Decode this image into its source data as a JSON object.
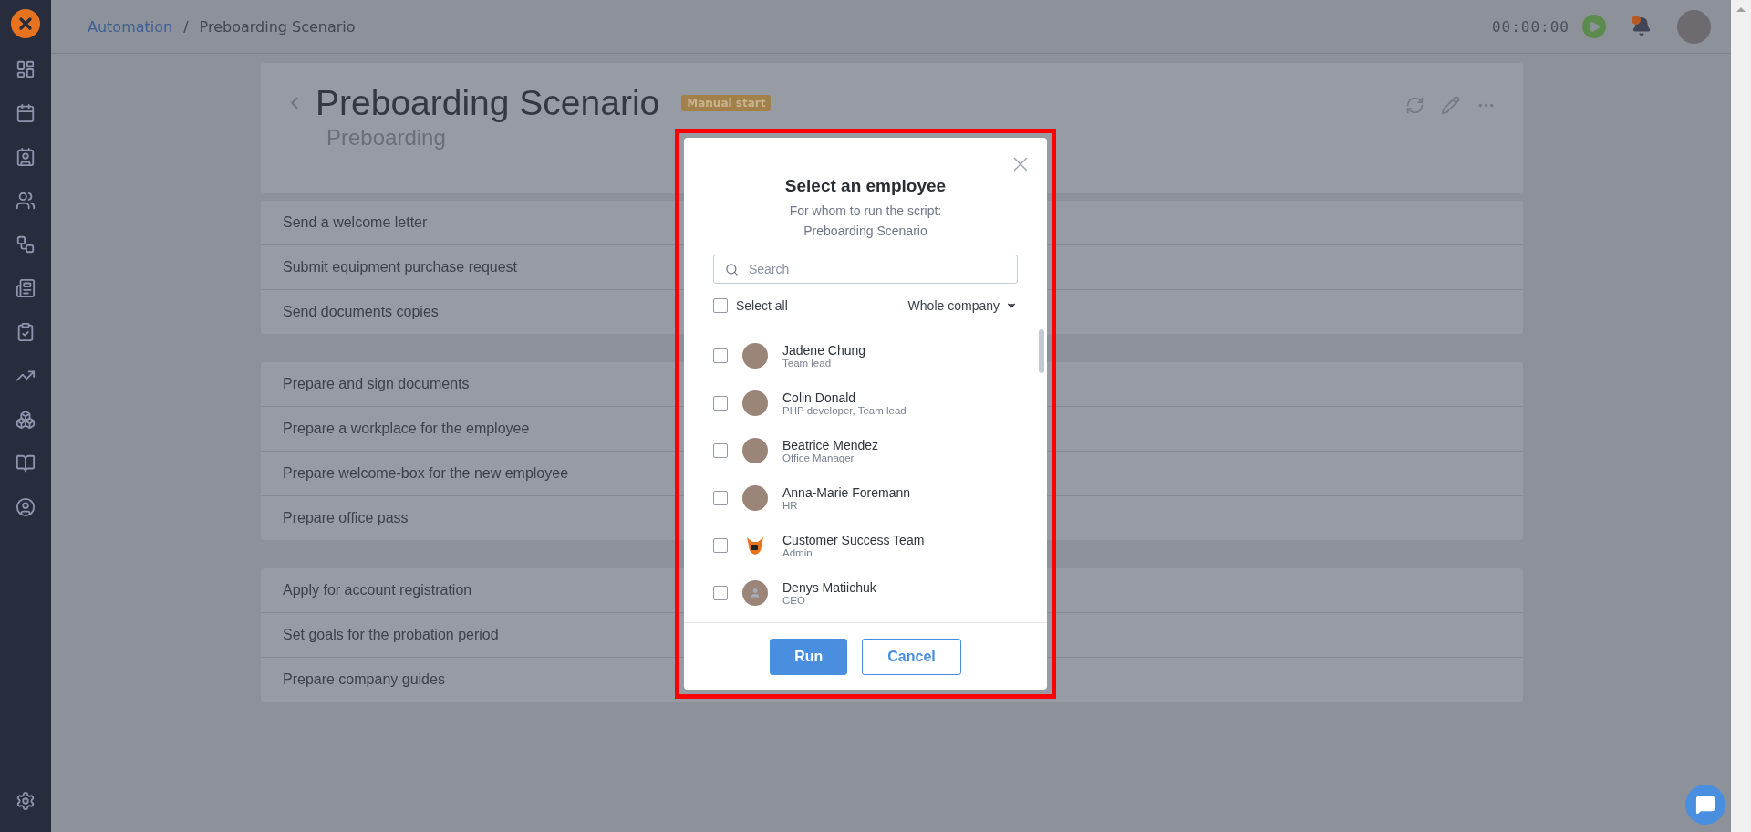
{
  "breadcrumb_separator": "/",
  "breadcrumb": [
    {
      "label": "Automation",
      "kind": "link"
    },
    {
      "label": "Preboarding Scenario",
      "kind": "current"
    }
  ],
  "timer": "00:00:00",
  "header": {
    "title": "Preboarding Scenario",
    "badge": "Manual start",
    "subtitle": "Preboarding"
  },
  "task_groups": [
    {
      "tasks": [
        "Send a welcome letter",
        "Submit equipment purchase request",
        "Send documents copies"
      ]
    },
    {
      "tasks": [
        "Prepare and sign documents",
        "Prepare a workplace for the employee",
        "Prepare welcome-box for the new employee",
        "Prepare office pass"
      ]
    },
    {
      "tasks": [
        "Apply for account registration",
        "Set goals for the probation period",
        "Prepare company guides"
      ]
    }
  ],
  "modal": {
    "title": "Select an employee",
    "subtitle_lines": [
      "For whom to run the script:",
      "Preboarding Scenario"
    ],
    "search": {
      "placeholder": "Search"
    },
    "select_all": {
      "label": "Select all",
      "checked": false
    },
    "filter": "Whole company",
    "employees": [
      {
        "name": "Jadene Chung",
        "role": "Team lead",
        "checked": false,
        "kind": "photo"
      },
      {
        "name": "Colin Donald",
        "role": "PHP developer, Team lead",
        "checked": false,
        "kind": "photo"
      },
      {
        "name": "Beatrice Mendez",
        "role": "Office Manager",
        "checked": false,
        "kind": "photo"
      },
      {
        "name": "Anna-Marie Foremann",
        "role": "HR",
        "checked": false,
        "kind": "photo"
      },
      {
        "name": "Customer Success Team",
        "role": "Admin",
        "checked": false,
        "kind": "logo"
      },
      {
        "name": "Denys Matiichuk",
        "role": "CEO",
        "checked": false,
        "kind": "placeholder"
      }
    ],
    "buttons": [
      {
        "label": "Run",
        "kind": "primary"
      },
      {
        "label": "Cancel",
        "kind": "secondary"
      }
    ]
  }
}
